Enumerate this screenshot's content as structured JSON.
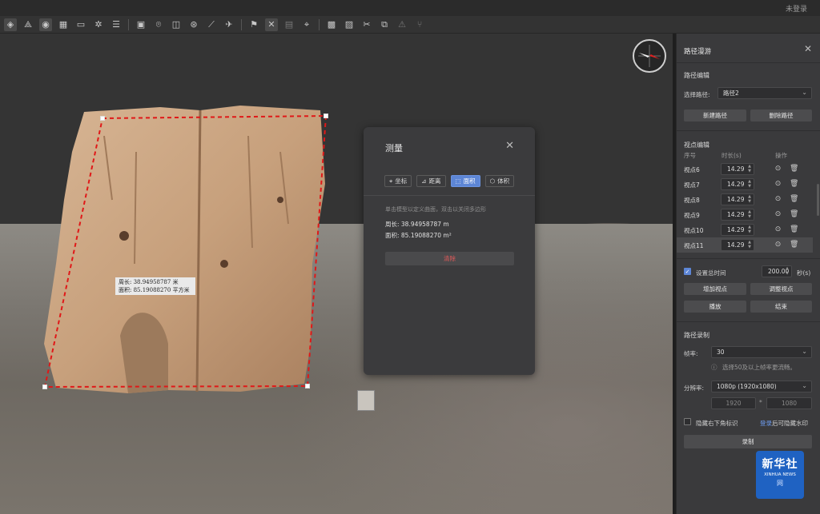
{
  "titlebar": {
    "login_text": "未登录"
  },
  "toolbar": {
    "icons": [
      "layers-icon",
      "triangle-network-icon",
      "model-icon",
      "grid-icon",
      "monitor-icon",
      "sun-icon",
      "sliders-icon",
      "image-icon",
      "focus-icon",
      "crop-icon",
      "layers3d-icon",
      "clip-icon",
      "rocket-icon",
      "flag-icon",
      "path-icon",
      "map-icon",
      "pin-icon",
      "terrain-icon",
      "mosaic-icon",
      "scissors-icon",
      "transform-icon",
      "warning-icon",
      "fork-icon"
    ]
  },
  "viewport": {
    "label": {
      "perimeter": "周长: 38.94958787 米",
      "area": "面积: 85.19088270 平方米"
    }
  },
  "measure_dialog": {
    "title": "测量",
    "tabs": [
      {
        "label": "坐标",
        "icon": "pin-icon"
      },
      {
        "label": "距离",
        "icon": "ruler-icon"
      },
      {
        "label": "面积",
        "icon": "area-icon"
      },
      {
        "label": "体积",
        "icon": "cube-icon"
      }
    ],
    "active_tab": "面积",
    "hint": "单击模型以定义曲面，双击以关闭多边形",
    "perimeter": "周长: 38.94958787 m",
    "area": "面积: 85.19088270 m²",
    "clear_label": "清除"
  },
  "path_panel": {
    "title": "路径漫游",
    "path_edit": "路径编辑",
    "select_path_label": "选择路径:",
    "selected_path": "路径2",
    "new_path": "新建路径",
    "delete_path": "删除路径",
    "viewpoint_edit": "视点编辑",
    "col_index": "序号",
    "col_duration": "时长(s)",
    "col_ops": "操作",
    "viewpoints": [
      {
        "name": "视点6",
        "duration": "14.29"
      },
      {
        "name": "视点7",
        "duration": "14.29"
      },
      {
        "name": "视点8",
        "duration": "14.29"
      },
      {
        "name": "视点9",
        "duration": "14.29"
      },
      {
        "name": "视点10",
        "duration": "14.29"
      },
      {
        "name": "视点11",
        "duration": "14.29"
      }
    ],
    "total_time_label": "设置总时间",
    "total_time_value": "200.00",
    "seconds_unit": "秒(s)",
    "add_viewpoint": "增加视点",
    "adjust_viewpoint": "调整视点",
    "play": "播放",
    "stop": "结束",
    "recording": "路径录制",
    "framerate_label": "帧率:",
    "framerate_value": "30",
    "framerate_hint": "选择50及以上帧率更流畅。",
    "resolution_label": "分辨率:",
    "resolution_value": "1080p (1920x1080)",
    "width_value": "1920",
    "times": "*",
    "height_value": "1080",
    "hide_watermark_label": "隐藏右下角标识",
    "login_link": "登录",
    "login_suffix": "后可隐藏水印",
    "record": "录制"
  },
  "watermark": {
    "cn": "新华社",
    "en": "XINHUA NEWS",
    "net": "网"
  }
}
